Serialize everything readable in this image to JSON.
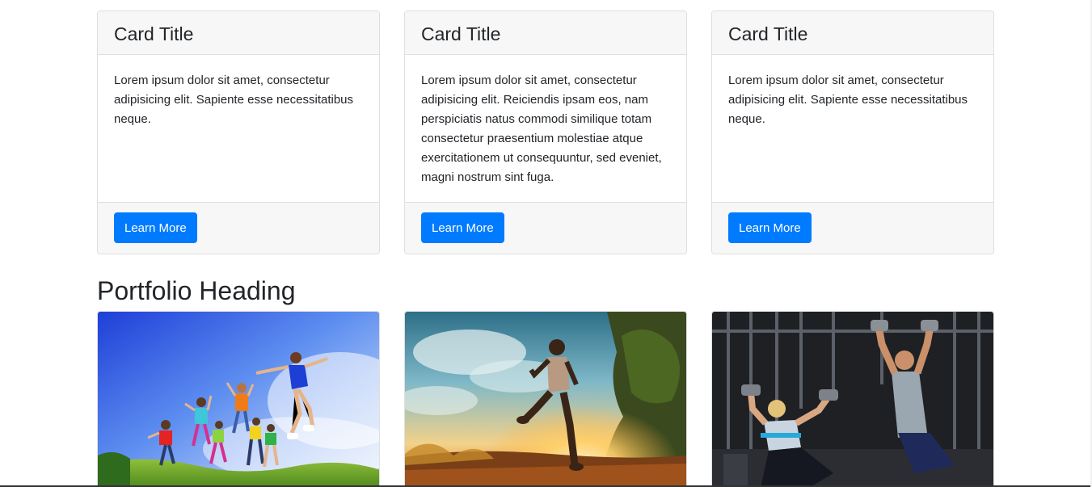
{
  "cards": [
    {
      "title": "Card Title",
      "text": "Lorem ipsum dolor sit amet, consectetur adipisicing elit. Sapiente esse necessitatibus neque.",
      "button": "Learn More"
    },
    {
      "title": "Card Title",
      "text": "Lorem ipsum dolor sit amet, consectetur adipisicing elit. Reiciendis ipsam eos, nam perspiciatis natus commodi similique totam consectetur praesentium molestiae atque exercitationem ut consequuntur, sed eveniet, magni nostrum sint fuga.",
      "button": "Learn More"
    },
    {
      "title": "Card Title",
      "text": "Lorem ipsum dolor sit amet, consectetur adipisicing elit. Sapiente esse necessitatibus neque.",
      "button": "Learn More"
    }
  ],
  "portfolio": {
    "heading": "Portfolio Heading"
  },
  "colors": {
    "primary": "#007bff",
    "card_header_bg": "#f7f7f7",
    "border": "#dfdfdf"
  }
}
